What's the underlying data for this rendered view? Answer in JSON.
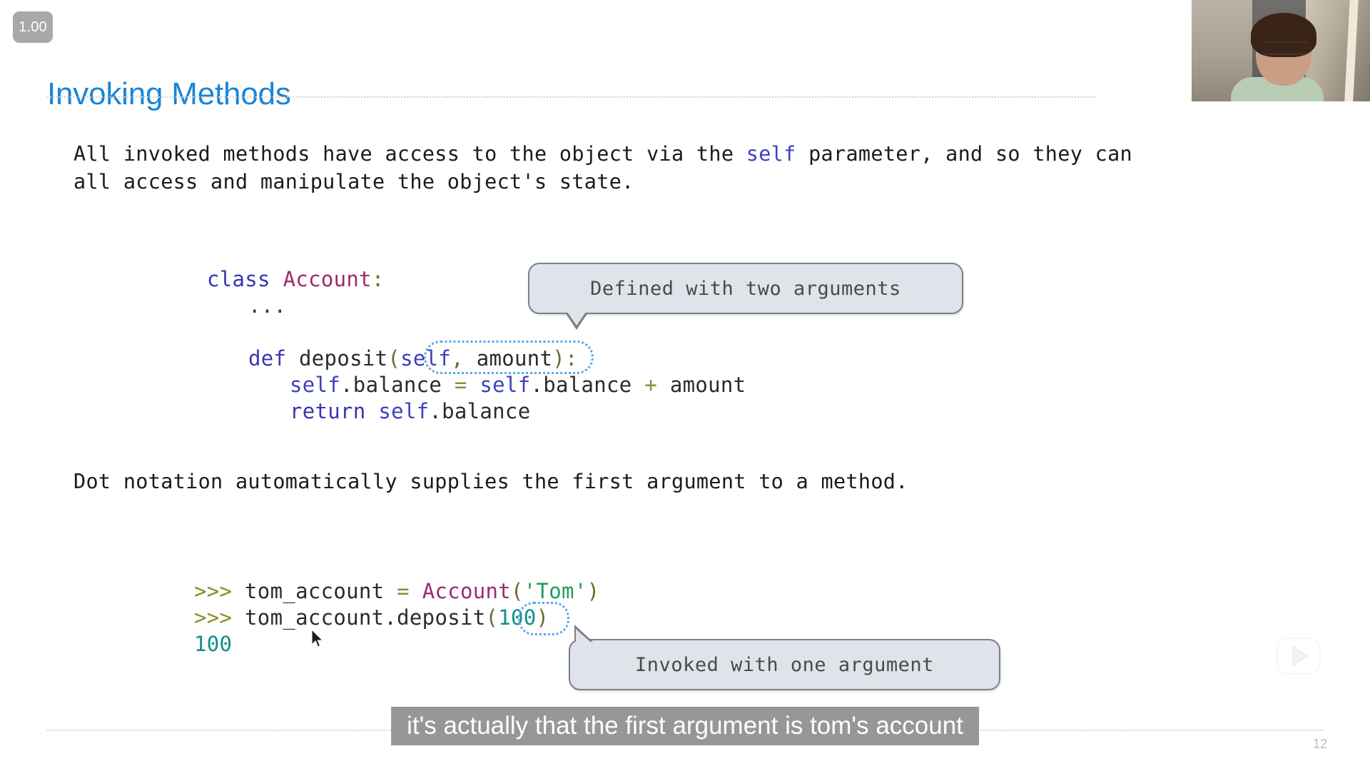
{
  "player": {
    "speed_badge": "1.00",
    "tv_play_icon": "tv-play-icon"
  },
  "slide": {
    "title": "Invoking Methods",
    "page_number": "12",
    "intro_text_before": "All invoked methods have access to the object via the ",
    "intro_keyword": "self",
    "intro_text_after": " parameter, and so they can\nall access and manipulate the object's state.",
    "dot_notation_text": "Dot notation automatically supplies the first argument to a method.",
    "code": {
      "line1_kw": "class",
      "line1_cls": " Account",
      "line1_colon": ":",
      "line2_ellipsis": "...",
      "line3_kw": "def",
      "line3_name": " deposit",
      "line3_open": "(",
      "line3_self": "self",
      "line3_comma": ", ",
      "line3_amount": "amount",
      "line3_close": ")",
      "line3_colon": ":",
      "line4_self1": "self",
      "line4_attr1": ".balance ",
      "line4_eq": "=",
      "line4_self2": " self",
      "line4_attr2": ".balance ",
      "line4_plus": "+",
      "line4_amount": " amount",
      "line5_kw": "return",
      "line5_self": " self",
      "line5_attr": ".balance"
    },
    "repl": {
      "line1_prompt": ">>> ",
      "line1_var": "tom_account ",
      "line1_eq": "=",
      "line1_cls": " Account",
      "line1_open": "(",
      "line1_str": "'Tom'",
      "line1_close": ")",
      "line2_prompt": ">>> ",
      "line2_expr": "tom_account.deposit",
      "line2_open": "(",
      "line2_arg": "100",
      "line2_close": ")",
      "line3_output": "100"
    },
    "callouts": {
      "defined": "Defined with two arguments",
      "invoked": "Invoked with one argument"
    }
  },
  "caption": {
    "text": "it's actually that the first argument is tom's account"
  },
  "colors": {
    "title_blue": "#1a85d6",
    "keyword_navy": "#3a36b0",
    "class_magenta": "#9e2b6e",
    "self_blue": "#3f3fbf",
    "string_green": "#1e9e5a",
    "output_teal": "#0f8f8f",
    "prompt_olive": "#8c8c2a",
    "callout_fill": "#dfe3ea",
    "callout_border": "#7c8086",
    "highlight_dotted": "#5aa7e8",
    "badge_gray": "#a8a8a8",
    "caption_bg": "#808080"
  }
}
